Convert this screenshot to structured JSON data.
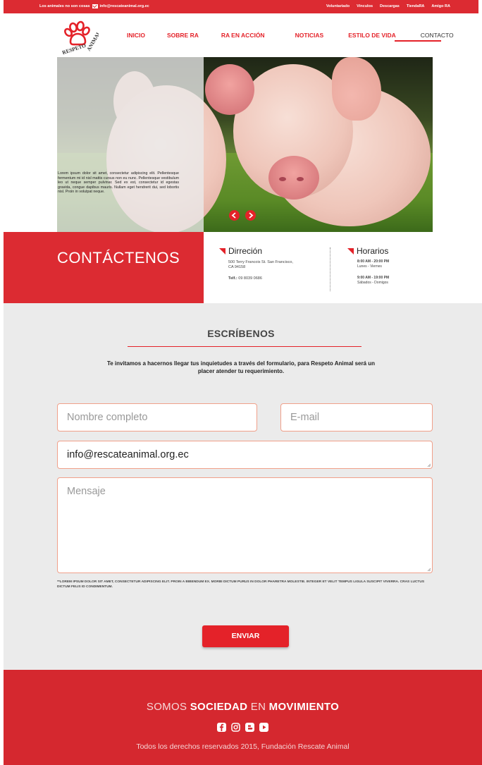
{
  "topbar": {
    "tagline": "Los animales no son cosas",
    "email": "info@rescateanimal.org.ec",
    "links": [
      "Voluntariado",
      "Vínculos",
      "Descargas",
      "TiendaRA",
      "Amigo RA"
    ]
  },
  "logo": {
    "text": "RESPETO ANIMAL"
  },
  "nav": {
    "items": [
      "INICIO",
      "SOBRE RA",
      "RA EN ACCIÓN",
      "NOTICIAS",
      "ESTILO DE VIDA",
      "CONTACTO"
    ],
    "active": "CONTACTO"
  },
  "hero": {
    "text": "Lorem ipsum dolor sit amet, consectetur adipiscing elit. Pellentesque fermentum mi id nisl mattis cursus non eu nunc. Pellentesque vestibulum leo ut neque semper pulvinar. Sed ex est, consectetur id egestas gravida, congue dapibus mauris. Nullam eget hendrerit dui, sed lobortis nisl. Proin in volutpat neque."
  },
  "contact": {
    "title": "CONTÁCTENOS",
    "address_heading": "Dirreción",
    "address_line1": "500 Terry Francois St. San Francisco,",
    "address_line2": "CA 94158",
    "phone_label": "Telf.:",
    "phone": "09 8039 0686",
    "hours_heading": "Horarios",
    "hours1_time": "8:00 AM - 20:00 PM",
    "hours1_days": "Lunes - Viernes",
    "hours2_time": "9:00 AM - 19:00 PM",
    "hours2_days": "Sábados - Domigos"
  },
  "form": {
    "title": "ESCRÍBENOS",
    "intro": "Te invitamos a hacernos llegar tus inquietudes a través del formulario, para Respeto Animal será un placer atender tu requerimiento.",
    "name_placeholder": "Nombre completo",
    "email_placeholder": "E-mail",
    "subject_value": "info@rescateanimal.org.ec",
    "message_placeholder": "Mensaje",
    "disclaimer": "**LOREM IPSUM DOLOR SIT AMET, CONSECTETUR ADIPISCING ELIT. PROIN A BIBENDUM EX. MORBI DICTUM PURUS IN DOLOR PHARETRA MOLESTIE. INTEGER ET VELIT TEMPUS LIGULA SUSCIPIT VIVERRA. CRAS LUCTUS DICTUM FELIS ID CONDIMENTUM.",
    "submit_label": "ENVIAR"
  },
  "footer": {
    "slogan_1": "SOMOS",
    "slogan_2": "SOCIEDAD",
    "slogan_3": "EN",
    "slogan_4": "MOVIMIENTO",
    "socials": [
      "facebook-icon",
      "instagram-icon",
      "blogger-icon",
      "youtube-icon"
    ],
    "copyright": "Todos los derechos reservados 2015, Fundación Rescate Animal"
  },
  "colors": {
    "accent": "#e42229",
    "footer": "#d5282f",
    "form_bg": "#ebebeb"
  }
}
